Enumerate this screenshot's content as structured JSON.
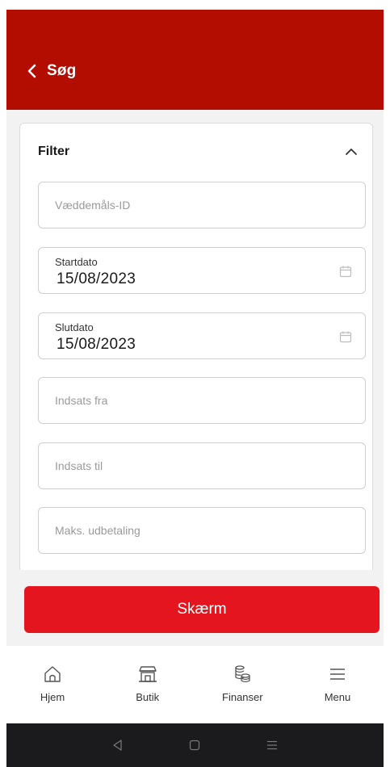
{
  "header": {
    "title": "Søg"
  },
  "filter": {
    "title": "Filter",
    "bet_id": {
      "placeholder": "Væddemåls-ID",
      "value": ""
    },
    "start_date": {
      "label": "Startdato",
      "value": "15/08/2023"
    },
    "end_date": {
      "label": "Slutdato",
      "value": "15/08/2023"
    },
    "stake_from": {
      "placeholder": "Indsats fra",
      "value": ""
    },
    "stake_to": {
      "placeholder": "Indsats til",
      "value": ""
    },
    "max_payout": {
      "placeholder": "Maks. udbetaling",
      "value": ""
    }
  },
  "submit": {
    "label": "Skærm"
  },
  "bottom_nav": {
    "items": [
      {
        "label": "Hjem",
        "icon": "home-icon"
      },
      {
        "label": "Butik",
        "icon": "store-icon"
      },
      {
        "label": "Finanser",
        "icon": "coins-icon"
      },
      {
        "label": "Menu",
        "icon": "hamburger-icon"
      }
    ]
  },
  "system_nav": {
    "icons": [
      "back-triangle-icon",
      "home-square-icon",
      "recents-icon"
    ]
  },
  "colors": {
    "header_bg": "#b30c00",
    "primary_button": "#e4151e",
    "system_bar": "#1b1b1d"
  }
}
